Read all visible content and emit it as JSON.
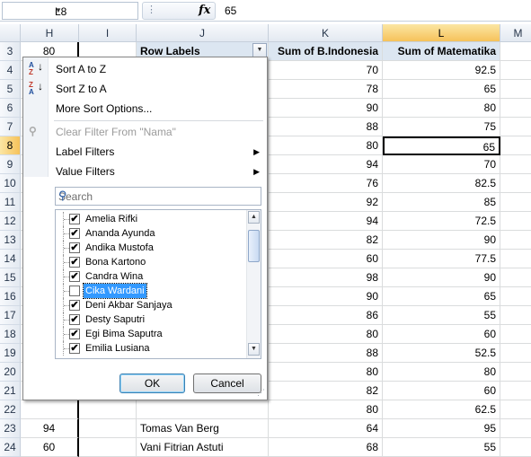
{
  "formula_bar": {
    "cell_ref": "L8",
    "fx_label": "fx",
    "value": "65"
  },
  "columns": [
    {
      "id": "H",
      "label": "H"
    },
    {
      "id": "I",
      "label": "I"
    },
    {
      "id": "J",
      "label": "J"
    },
    {
      "id": "K",
      "label": "K"
    },
    {
      "id": "L",
      "label": "L"
    },
    {
      "id": "M",
      "label": "M"
    }
  ],
  "rows": [
    {
      "n": "3",
      "h": "80",
      "j": "Row Labels",
      "k": "Sum of B.Indonesia",
      "l": "Sum of Matematika"
    },
    {
      "n": "4",
      "h": "",
      "j": "",
      "k": "70",
      "l": "92.5"
    },
    {
      "n": "5",
      "h": "",
      "j": "",
      "k": "78",
      "l": "65"
    },
    {
      "n": "6",
      "h": "",
      "j": "",
      "k": "90",
      "l": "80"
    },
    {
      "n": "7",
      "h": "",
      "j": "",
      "k": "88",
      "l": "75"
    },
    {
      "n": "8",
      "h": "",
      "j": "",
      "k": "80",
      "l": "65"
    },
    {
      "n": "9",
      "h": "",
      "j": "",
      "k": "94",
      "l": "70"
    },
    {
      "n": "10",
      "h": "",
      "j": "",
      "k": "76",
      "l": "82.5"
    },
    {
      "n": "11",
      "h": "",
      "j": "",
      "k": "92",
      "l": "85"
    },
    {
      "n": "12",
      "h": "",
      "j": "",
      "k": "94",
      "l": "72.5"
    },
    {
      "n": "13",
      "h": "",
      "j": "",
      "k": "82",
      "l": "90"
    },
    {
      "n": "14",
      "h": "",
      "j": "",
      "k": "60",
      "l": "77.5"
    },
    {
      "n": "15",
      "h": "",
      "j": "",
      "k": "98",
      "l": "90"
    },
    {
      "n": "16",
      "h": "",
      "j": "",
      "k": "90",
      "l": "65"
    },
    {
      "n": "17",
      "h": "",
      "j": "",
      "k": "86",
      "l": "55"
    },
    {
      "n": "18",
      "h": "",
      "j": "",
      "k": "80",
      "l": "60"
    },
    {
      "n": "19",
      "h": "",
      "j": "",
      "k": "88",
      "l": "52.5"
    },
    {
      "n": "20",
      "h": "",
      "j": "",
      "k": "80",
      "l": "80"
    },
    {
      "n": "21",
      "h": "",
      "j": "",
      "k": "82",
      "l": "60"
    },
    {
      "n": "22",
      "h": "",
      "j": "",
      "k": "80",
      "l": "62.5"
    },
    {
      "n": "23",
      "h": "94",
      "j": "Tomas Van Berg",
      "k": "64",
      "l": "95"
    },
    {
      "n": "24",
      "h": "60",
      "j": "Vani Fitrian Astuti",
      "k": "68",
      "l": "55"
    }
  ],
  "filter_menu": {
    "sort_az": "Sort A to Z",
    "sort_za": "Sort Z to A",
    "more_sort": "More Sort Options...",
    "clear_filter": "Clear Filter From \"Nama\"",
    "label_filters": "Label Filters",
    "value_filters": "Value Filters",
    "search_placeholder": "Search",
    "items": [
      {
        "name": "Amelia Rifki",
        "checked": true
      },
      {
        "name": "Ananda Ayunda",
        "checked": true
      },
      {
        "name": "Andika Mustofa",
        "checked": true
      },
      {
        "name": "Bona Kartono",
        "checked": true
      },
      {
        "name": "Candra Wina",
        "checked": true
      },
      {
        "name": "Cika Wardani",
        "checked": false
      },
      {
        "name": "Deni Akbar Sanjaya",
        "checked": true
      },
      {
        "name": "Desty Saputri",
        "checked": true
      },
      {
        "name": "Egi Bima Saputra",
        "checked": true
      },
      {
        "name": "Emilia Lusiana",
        "checked": true
      }
    ],
    "ok": "OK",
    "cancel": "Cancel"
  }
}
